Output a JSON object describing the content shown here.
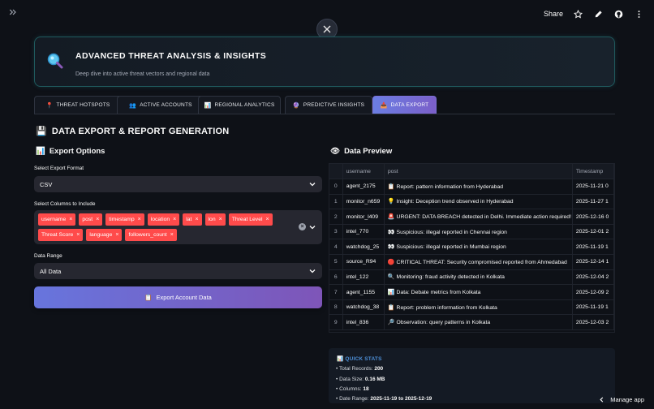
{
  "topbar": {
    "share_label": "Share",
    "icons": [
      "chevrons-right-icon",
      "star-icon",
      "pencil-icon",
      "github-icon",
      "more-vertical-icon"
    ]
  },
  "hero": {
    "title": "ADVANCED THREAT ANALYSIS & INSIGHTS",
    "subtitle": "Deep dive into active threat vectors and regional data",
    "icon": "magnifier-icon"
  },
  "tabs": [
    {
      "icon": "📍",
      "label": "THREAT HOTSPOTS"
    },
    {
      "icon": "👥",
      "label": "ACTIVE ACCOUNTS"
    },
    {
      "icon": "📊",
      "label": "REGIONAL ANALYTICS"
    },
    {
      "icon": "🔮",
      "label": "PREDICTIVE INSIGHTS"
    },
    {
      "icon": "📥",
      "label": "DATA EXPORT",
      "active": true
    }
  ],
  "section": {
    "icon": "💾",
    "title": "DATA EXPORT & REPORT GENERATION"
  },
  "export_options": {
    "icon": "📊",
    "heading": "Export Options",
    "format_label": "Select Export Format",
    "format_value": "CSV",
    "columns_label": "Select Columns to Include",
    "columns": [
      "username",
      "post",
      "timestamp",
      "location",
      "lat",
      "lon",
      "Threat Level",
      "Threat Score",
      "language",
      "followers_count"
    ],
    "range_label": "Data Range",
    "range_value": "All Data",
    "button_label": "Export Account Data",
    "button_icon": "📋"
  },
  "preview": {
    "icon": "👁",
    "heading": "Data Preview",
    "headers": [
      "",
      "username",
      "post",
      "Timestamp"
    ],
    "rows": [
      {
        "idx": "0",
        "username": "agent_2175",
        "emoji": "📋",
        "post": "Report: pattern information from Hyderabad",
        "ts": "2025-11-21 0"
      },
      {
        "idx": "1",
        "username": "monitor_n659",
        "emoji": "💡",
        "post": "Insight: Deception trend observed in Hyderabad",
        "ts": "2025-11-27 1"
      },
      {
        "idx": "2",
        "username": "monitor_l409",
        "emoji": "🚨",
        "post": "URGENT: DATA BREACH detected in Delhi. Immediate action required!",
        "ts": "2025-12-16 0"
      },
      {
        "idx": "3",
        "username": "intel_770",
        "emoji": "👀",
        "post": "Suspicious: illegal reported in Chennai region",
        "ts": "2025-12-01 2"
      },
      {
        "idx": "4",
        "username": "watchdog_25",
        "emoji": "👀",
        "post": "Suspicious: illegal reported in Mumbai region",
        "ts": "2025-11-19 1"
      },
      {
        "idx": "5",
        "username": "source_R94",
        "emoji": "🔴",
        "post": "CRITICAL THREAT: Security compromised reported from Ahmedabad",
        "ts": "2025-12-14 1"
      },
      {
        "idx": "6",
        "username": "intel_122",
        "emoji": "🔍",
        "post": "Monitoring: fraud activity detected in Kolkata",
        "ts": "2025-12-04 2"
      },
      {
        "idx": "7",
        "username": "agent_1155",
        "emoji": "📊",
        "post": "Data: Debate metrics from Kolkata",
        "ts": "2025-12-09 2"
      },
      {
        "idx": "8",
        "username": "watchdog_38",
        "emoji": "📋",
        "post": "Report: problem information from Kolkata",
        "ts": "2025-11-19 1"
      },
      {
        "idx": "9",
        "username": "intel_836",
        "emoji": "🔎",
        "post": "Observation: query patterns in Kolkata",
        "ts": "2025-12-03 2"
      }
    ]
  },
  "quick_stats": {
    "icon": "📊",
    "title": "QUICK STATS",
    "total_records_label": "Total Records:",
    "total_records": "200",
    "data_size_label": "Data Size:",
    "data_size": "0.16 MB",
    "columns_label": "Columns:",
    "columns": "18",
    "date_range_label": "Date Range:",
    "date_range": "2025-11-19 to 2025-12-19"
  },
  "footer": {
    "manage_label": "Manage app"
  },
  "colors": {
    "accent": "#ff4b4b",
    "tab_active_start": "#6b7ee3",
    "tab_active_end": "#7b5fc9",
    "stats_title": "#4d8ed6",
    "hero_border": "#1f5a5e"
  }
}
